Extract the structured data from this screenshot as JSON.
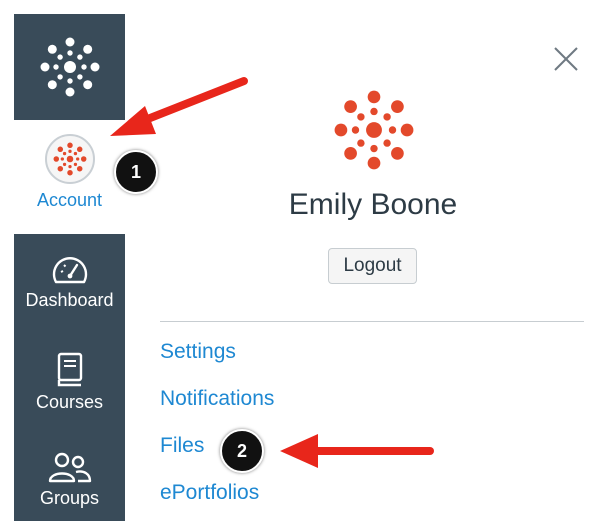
{
  "sidebar": {
    "items": [
      {
        "label": "Account",
        "icon": "account-avatar-icon"
      },
      {
        "label": "Dashboard",
        "icon": "dashboard-gauge-icon"
      },
      {
        "label": "Courses",
        "icon": "courses-book-icon"
      },
      {
        "label": "Groups",
        "icon": "groups-people-icon"
      }
    ]
  },
  "tray": {
    "user_name": "Emily Boone",
    "logout_label": "Logout",
    "links": [
      "Settings",
      "Notifications",
      "Files",
      "ePortfolios"
    ]
  },
  "annotations": {
    "step1": "1",
    "step2": "2"
  },
  "colors": {
    "nav_bg": "#394b59",
    "link_blue": "#1e88d2",
    "canvas_red": "#e3492b",
    "arrow_red": "#e8261b"
  }
}
